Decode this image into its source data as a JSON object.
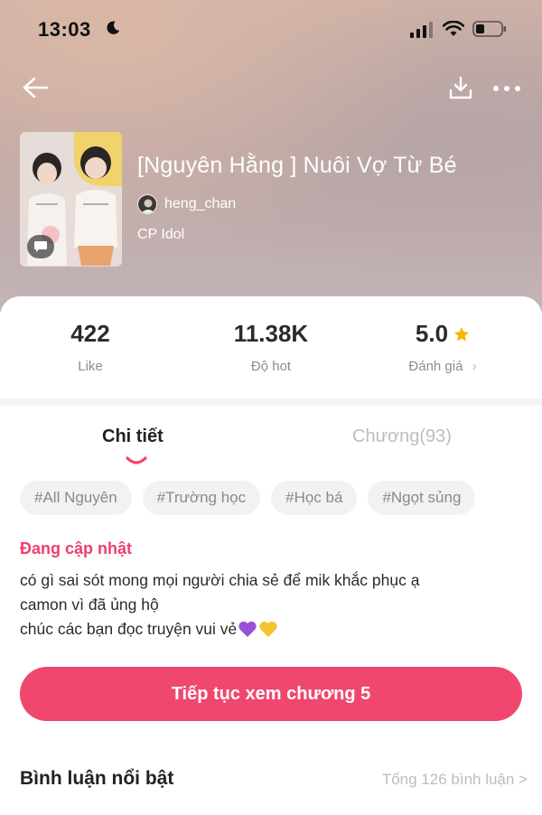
{
  "status_bar": {
    "time": "13:03"
  },
  "story": {
    "title": "[Nguyên Hằng ] Nuôi Vợ Từ Bé",
    "author": "heng_chan",
    "category": "CP Idol"
  },
  "stats": [
    {
      "value": "422",
      "label": "Like"
    },
    {
      "value": "11.38K",
      "label": "Độ hot"
    },
    {
      "value": "5.0",
      "label": "Đánh giá",
      "chevron": "›"
    }
  ],
  "tabs": {
    "details": "Chi tiết",
    "chapters": "Chương(93)"
  },
  "tags": [
    "#All Nguyên",
    "#Trường học",
    "#Học bá",
    "#Ngọt sủng"
  ],
  "update_label": "Đang cập nhật",
  "description": [
    "có gì sai sót mong mọi người chia sẻ để mik khắc phục ạ",
    "camon vì đã ủng hộ",
    "chúc các bạn đọc truyện vui vẻ"
  ],
  "cta_label": "Tiếp tục xem chương 5",
  "comments": {
    "title": "Bình luận nổi bật",
    "total": "Tổng 126 bình luận >"
  },
  "colors": {
    "accent": "#f0476f",
    "update": "#ee3f6f",
    "star": "#f5b800"
  },
  "icons": [
    "moon-icon",
    "signal-icon",
    "wifi-icon",
    "battery-icon",
    "back-arrow-icon",
    "download-icon",
    "more-icon",
    "comment-bubble-icon",
    "star-icon",
    "purple-heart-icon",
    "yellow-heart-icon"
  ]
}
